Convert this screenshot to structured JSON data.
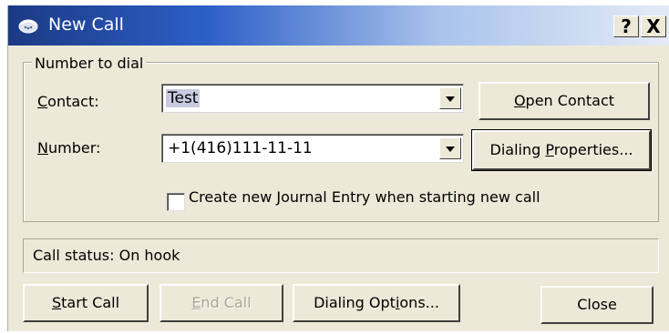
{
  "window": {
    "title": "New Call",
    "help_button": "?",
    "close_button": "X"
  },
  "group": {
    "title": "Number to dial"
  },
  "contact": {
    "label_prefix": "",
    "label_mnemonic": "C",
    "label_rest": "ontact:",
    "value": "Test"
  },
  "number": {
    "label_mnemonic": "N",
    "label_rest": "umber:",
    "value": "+1(416)111-11-11"
  },
  "buttons": {
    "open_contact_mnemonic": "O",
    "open_contact_rest": "pen Contact",
    "dialing_properties_prefix": "Dialing ",
    "dialing_properties_mnemonic": "P",
    "dialing_properties_rest": "roperties...",
    "start_call_mnemonic": "S",
    "start_call_rest": "tart Call",
    "end_call_mnemonic": "E",
    "end_call_rest": "nd Call",
    "dialing_options_prefix": "Dialing Opt",
    "dialing_options_mnemonic": "i",
    "dialing_options_rest": "ons...",
    "close": "Close"
  },
  "journal": {
    "label_prefix": "Create new ",
    "label_mnemonic": "J",
    "label_rest": "ournal Entry when starting new call",
    "checked": false
  },
  "status": {
    "text": "Call status: On hook"
  },
  "colors": {
    "title_gradient_start": "#1c3a84",
    "dialog_background": "#ece9d8",
    "selection_highlight": "#c8cbe0"
  }
}
